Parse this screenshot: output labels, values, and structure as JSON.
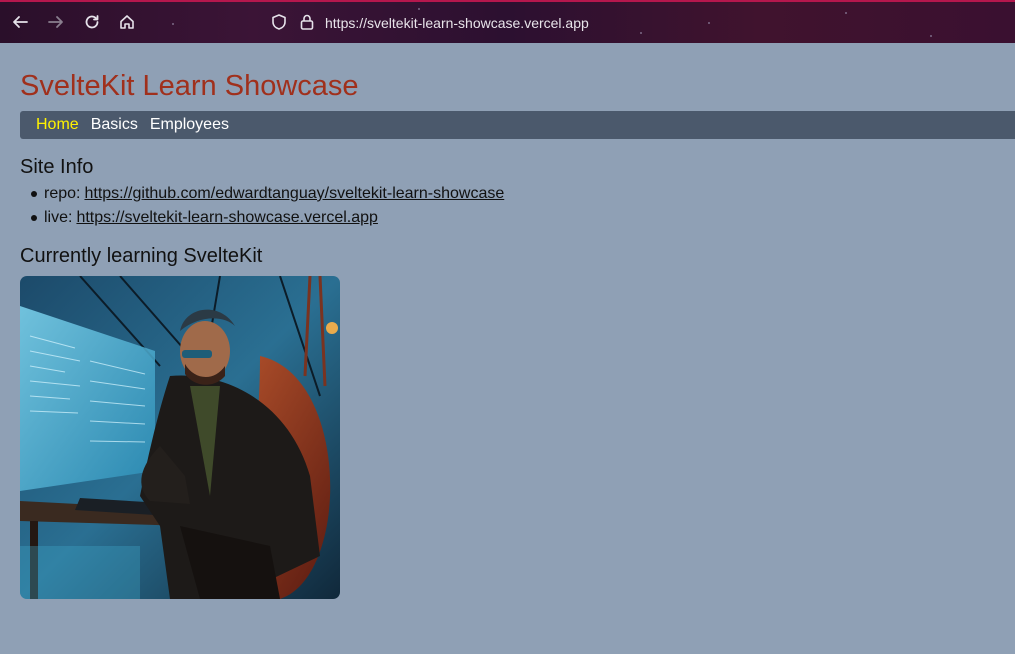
{
  "browser": {
    "url": "https://sveltekit-learn-showcase.vercel.app",
    "icons": [
      "back-arrow-icon",
      "forward-arrow-icon",
      "reload-icon",
      "home-icon",
      "shield-icon",
      "lock-icon"
    ]
  },
  "page": {
    "title": "SvelteKit Learn Showcase",
    "nav": [
      {
        "label": "Home",
        "active": true
      },
      {
        "label": "Basics",
        "active": false
      },
      {
        "label": "Employees",
        "active": false
      }
    ],
    "site_info": {
      "heading": "Site Info",
      "items": [
        {
          "label": "repo:",
          "link": "https://github.com/edwardtanguay/sveltekit-learn-showcase"
        },
        {
          "label": "live:",
          "link": "https://sveltekit-learn-showcase.vercel.app"
        }
      ]
    },
    "learning": {
      "heading": "Currently learning SvelteKit",
      "image_alt": "cyberpunk developer at computer"
    }
  },
  "colors": {
    "page_bg": "#8fa0b5",
    "title": "#a0301c",
    "nav_bg": "#4b596c",
    "nav_active": "#fff200",
    "toolbar_accent": "#b5174d"
  }
}
